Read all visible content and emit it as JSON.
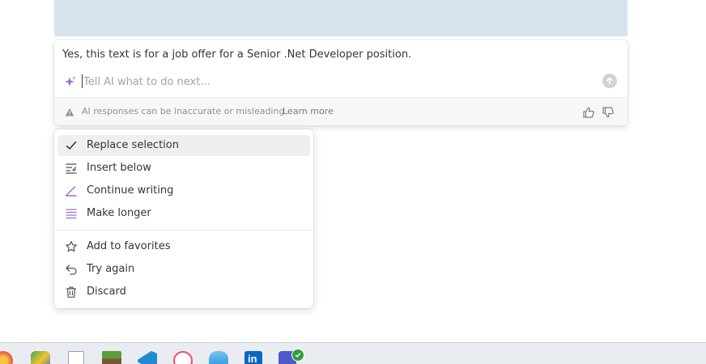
{
  "ai": {
    "response_text": "Yes, this text is for a job offer for a Senior .Net Developer position.",
    "prompt_placeholder": "Tell AI what to do next...",
    "prompt_value": "",
    "disclaimer": "AI responses can be inaccurate or misleading.",
    "learn_more": "Learn more"
  },
  "menu": {
    "primary": [
      {
        "label": "Replace selection",
        "icon": "check-icon",
        "active": true
      },
      {
        "label": "Insert below",
        "icon": "insert-below-icon"
      },
      {
        "label": "Continue writing",
        "icon": "pen-line-icon"
      },
      {
        "label": "Make longer",
        "icon": "lines-icon"
      }
    ],
    "secondary": [
      {
        "label": "Add to favorites",
        "icon": "star-icon"
      },
      {
        "label": "Try again",
        "icon": "undo-arrow-icon"
      },
      {
        "label": "Discard",
        "icon": "trash-icon"
      }
    ]
  },
  "colors": {
    "accent_purple": "#9a6dd7",
    "selection": "#d9e3f0",
    "menu_active": "#efefee"
  },
  "taskbar": {
    "apps": [
      "browser-icon",
      "paint-icon",
      "file-icon",
      "minecraft-icon",
      "vscode-icon",
      "itunes-icon",
      "cloud-icon",
      "linkedin-icon",
      "teams-icon"
    ]
  }
}
